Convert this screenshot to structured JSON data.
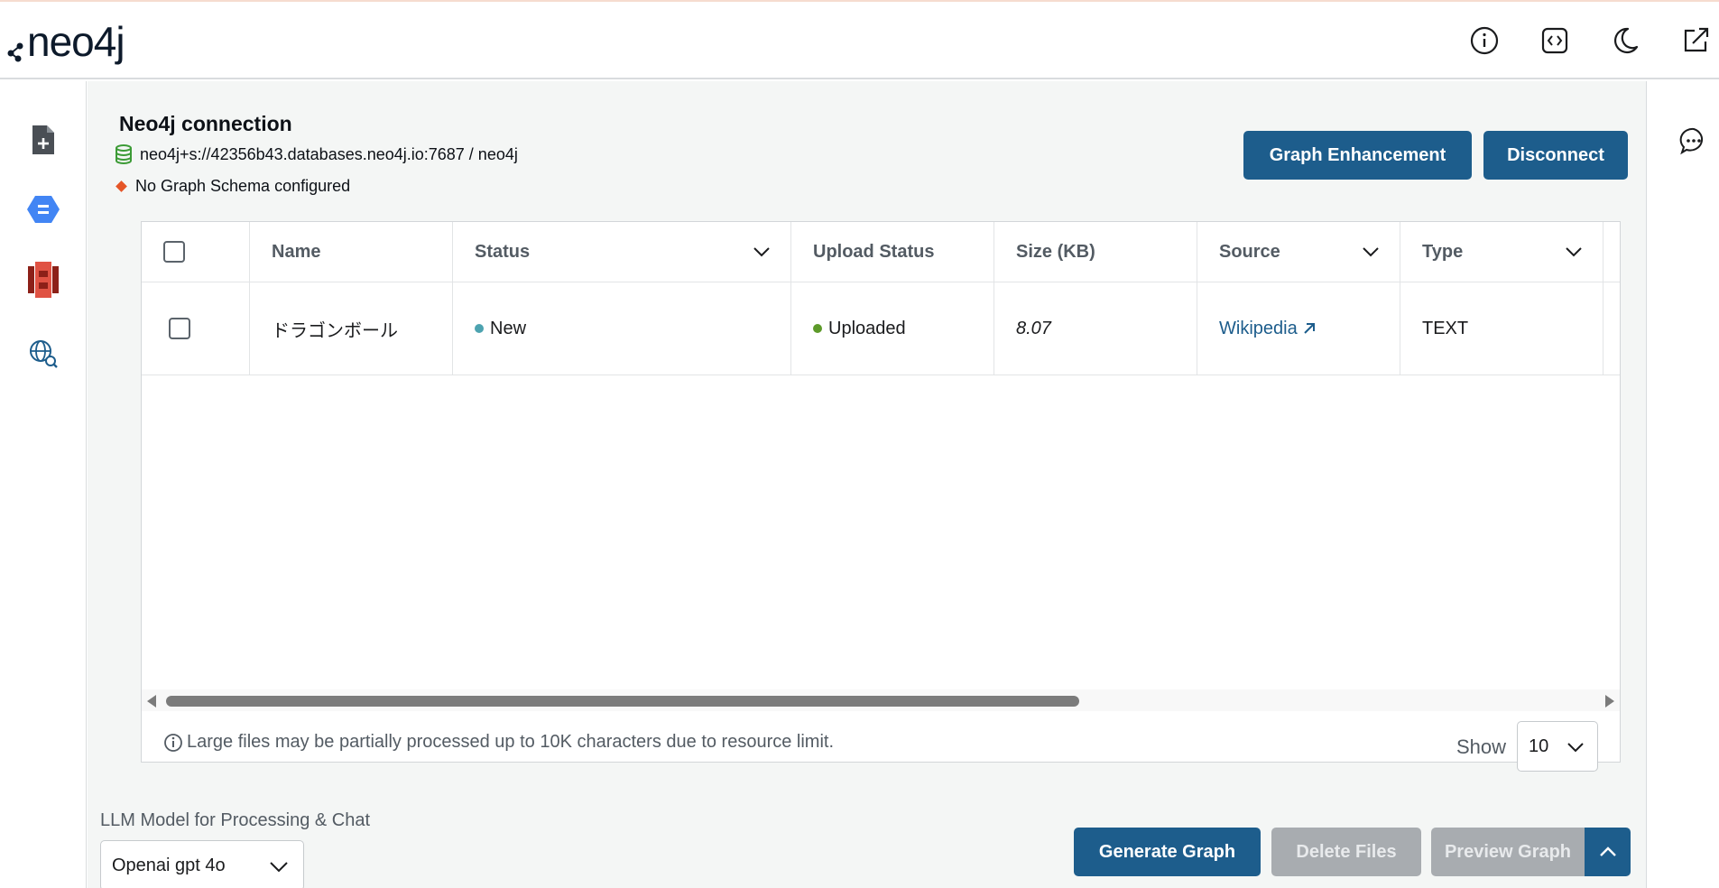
{
  "header": {
    "logo_text": "neo4j",
    "icons": [
      "info-icon",
      "code-icon",
      "moon-icon",
      "external-link-icon"
    ]
  },
  "sidebar": {
    "icons": [
      "file-add-icon",
      "google-cloud-storage-icon",
      "aws-s3-icon",
      "web-search-icon"
    ]
  },
  "rightbar": {
    "icons": [
      "chat-icon"
    ]
  },
  "connection": {
    "title": "Neo4j connection",
    "uri": "neo4j+s://42356b43.databases.neo4j.io:7687 / neo4j",
    "schema_status": "No Graph Schema configured"
  },
  "actions": {
    "graph_enhancement": "Graph Enhancement",
    "disconnect": "Disconnect"
  },
  "table": {
    "columns": [
      "Name",
      "Status",
      "Upload Status",
      "Size (KB)",
      "Source",
      "Type"
    ],
    "rows": [
      {
        "name": "ドラゴンボール",
        "status": "New",
        "upload_status": "Uploaded",
        "size_kb": "8.07",
        "source": "Wikipedia",
        "type": "TEXT"
      }
    ],
    "note": "Large files may be partially processed up to 10K characters due to resource limit.",
    "show_label": "Show",
    "page_size": "10"
  },
  "llm": {
    "label": "LLM Model for Processing & Chat",
    "selected": "Openai gpt 4o"
  },
  "bottom_actions": {
    "generate_graph": "Generate Graph",
    "delete_files": "Delete Files",
    "preview_graph": "Preview Graph"
  },
  "colors": {
    "primary": "#1d5d8c",
    "status_new": "#4da3b0",
    "status_uploaded": "#5d9a2a",
    "schema_warning": "#e55527",
    "db_icon": "#3c9b36"
  }
}
